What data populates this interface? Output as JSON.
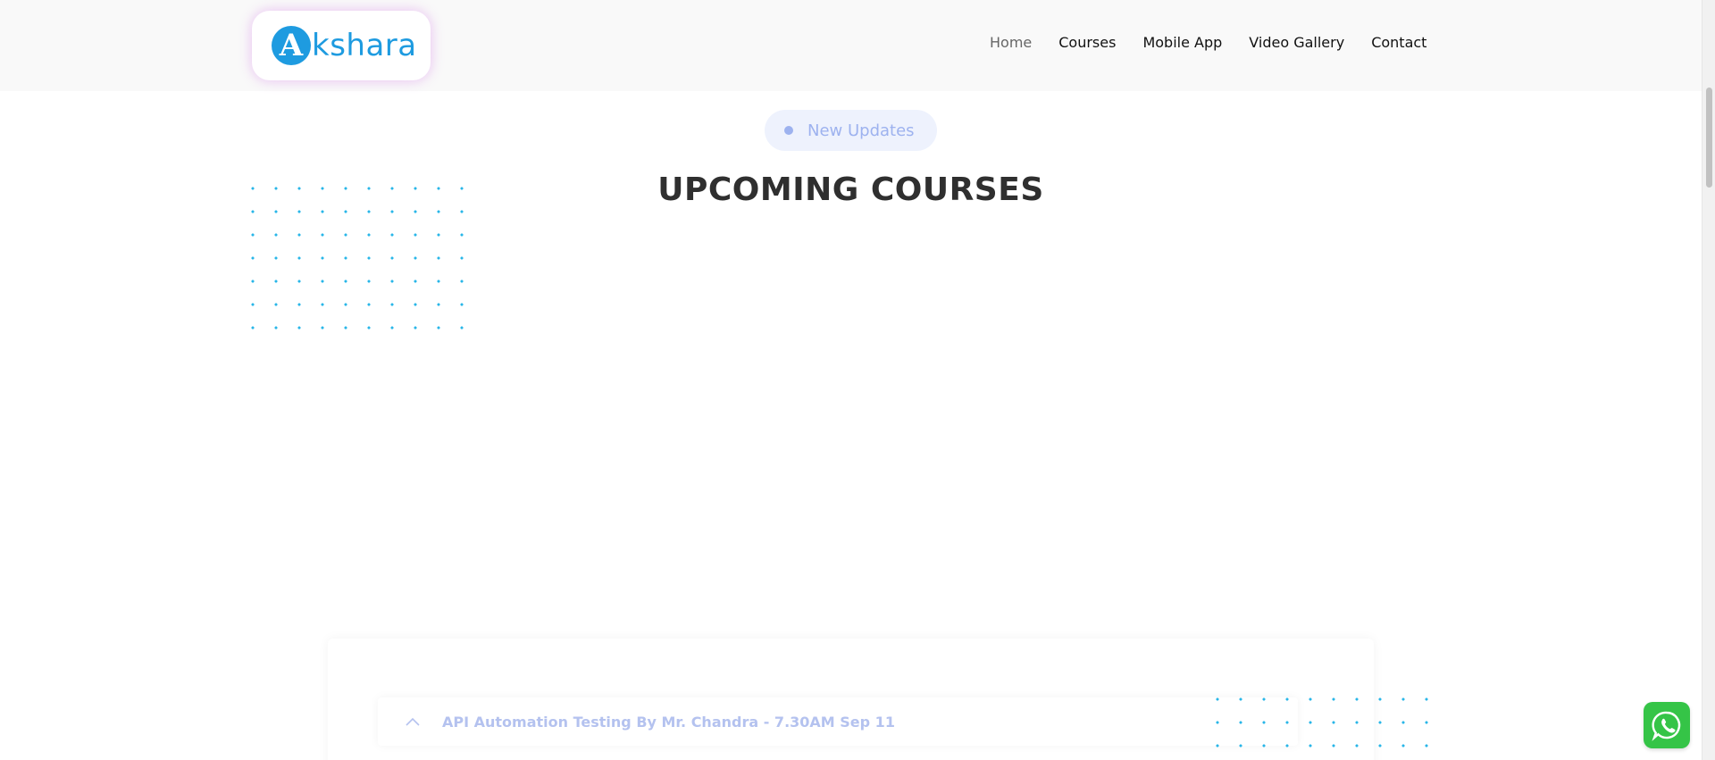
{
  "header": {
    "logo": {
      "mark": "A",
      "text": "kshara"
    },
    "nav": [
      {
        "label": "Home",
        "active": true
      },
      {
        "label": "Courses"
      },
      {
        "label": "Mobile App"
      },
      {
        "label": "Video Gallery"
      },
      {
        "label": "Contact"
      }
    ]
  },
  "section": {
    "badge": "New Updates",
    "title": "UPCOMING COURSES"
  },
  "courses": [
    {
      "label": "API Automation Testing By Mr. Chandra - 7.30AM Sep 11"
    }
  ],
  "colors": {
    "brand": "#1e9be0",
    "badge_bg": "#eef2fd",
    "badge_text": "#9db2ef",
    "dots": "#29b6e8",
    "whatsapp": "#35c447"
  },
  "icons": [
    "chevron-up-icon",
    "whatsapp-icon"
  ]
}
